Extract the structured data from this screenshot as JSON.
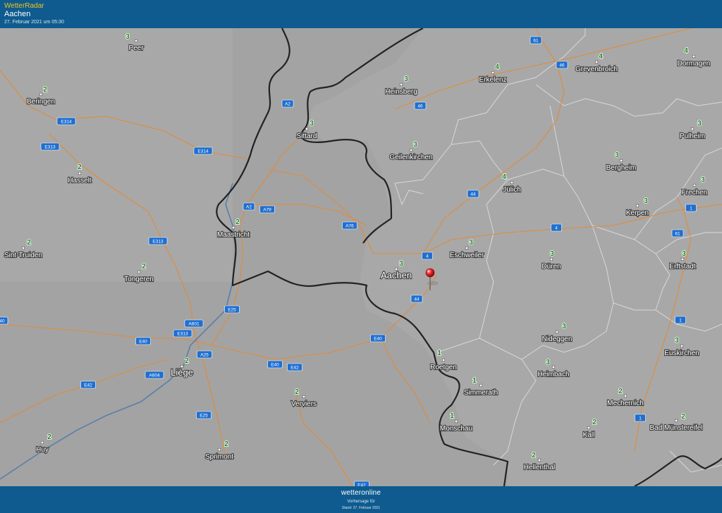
{
  "header": {
    "brand": "WetterRadar",
    "location": "Aachen",
    "datetime": "27. Februar 2021 um 05:30"
  },
  "footer": {
    "logo": "wetteronline",
    "subtitle": "Vorhersage für",
    "stand": "Stand: 27. Februar 2021"
  },
  "marker": {
    "name": "location-pin",
    "color": "#d91f1f"
  },
  "cities": [
    {
      "name": "Peer",
      "value": "3"
    },
    {
      "name": "Beringen",
      "value": "2"
    },
    {
      "name": "Hasselt",
      "value": "2"
    },
    {
      "name": "Sint-Truiden",
      "value": "2"
    },
    {
      "name": "Tongeren",
      "value": "2"
    },
    {
      "name": "Liège",
      "value": "2"
    },
    {
      "name": "Huy",
      "value": "2"
    },
    {
      "name": "Sprimont",
      "value": "2"
    },
    {
      "name": "Verviers",
      "value": "2"
    },
    {
      "name": "Maastricht",
      "value": "2"
    },
    {
      "name": "Sittard",
      "value": "3"
    },
    {
      "name": "Heinsberg",
      "value": "3"
    },
    {
      "name": "Geilenkirchen",
      "value": "3"
    },
    {
      "name": "Erkelenz",
      "value": "4"
    },
    {
      "name": "Grevenbroich",
      "value": "4"
    },
    {
      "name": "Dormagen",
      "value": "4"
    },
    {
      "name": "Pulheim",
      "value": "3"
    },
    {
      "name": "Bergheim",
      "value": "3"
    },
    {
      "name": "Jülich",
      "value": "4"
    },
    {
      "name": "Frechen",
      "value": "3"
    },
    {
      "name": "Kerpen",
      "value": "3"
    },
    {
      "name": "Eschweiler",
      "value": "3"
    },
    {
      "name": "Aachen",
      "value": "3"
    },
    {
      "name": "Düren",
      "value": "3"
    },
    {
      "name": "Erftstadt",
      "value": "3"
    },
    {
      "name": "Nideggen",
      "value": "3"
    },
    {
      "name": "Euskirchen",
      "value": "3"
    },
    {
      "name": "Roetgen",
      "value": "1"
    },
    {
      "name": "Heimbach",
      "value": "3"
    },
    {
      "name": "Simmerath",
      "value": "1"
    },
    {
      "name": "Mechernich",
      "value": "2"
    },
    {
      "name": "Monschau",
      "value": "1"
    },
    {
      "name": "Kall",
      "value": "2"
    },
    {
      "name": "Bad Münstereifel",
      "value": "2"
    },
    {
      "name": "Hellenthal",
      "value": "2"
    }
  ],
  "roads": [
    "61",
    "46",
    "46",
    "A2",
    "E314",
    "E313",
    "E314",
    "A2",
    "A79",
    "A76",
    "44",
    "4",
    "4",
    "1",
    "61",
    "E313",
    "A601",
    "E313",
    "E25",
    "E40",
    "40",
    "A25",
    "A604",
    "E42",
    "E40",
    "E42",
    "44",
    "E40",
    "E25",
    "1",
    "1",
    "E42"
  ]
}
